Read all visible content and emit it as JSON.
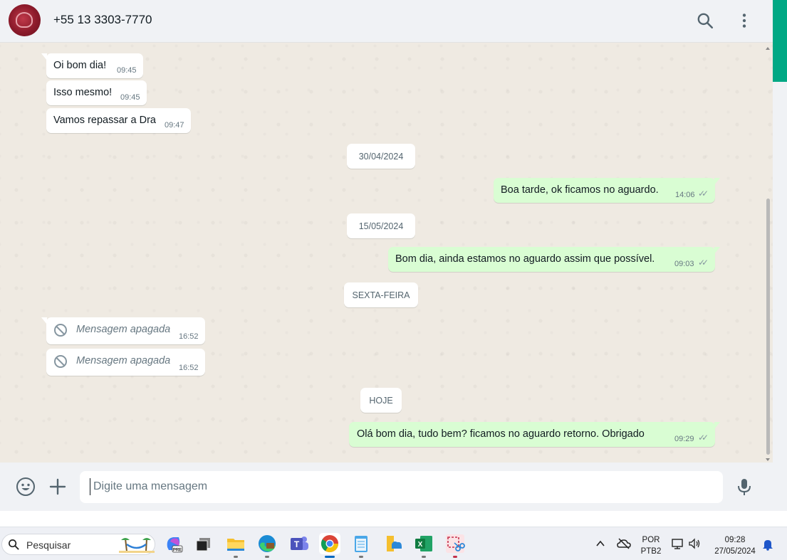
{
  "header": {
    "contact_name": "+55 13 3303-7770",
    "icons": [
      "search-icon",
      "menu-dots-icon"
    ]
  },
  "messages": [
    {
      "direction": "in",
      "text": "Oi bom dia!",
      "time": "09:45"
    },
    {
      "direction": "in",
      "text": "Isso mesmo!",
      "time": "09:45"
    },
    {
      "direction": "in",
      "text": "Vamos repassar a Dra",
      "time": "09:47"
    },
    {
      "divider": "30/04/2024"
    },
    {
      "direction": "out",
      "text": "Boa tarde, ok ficamos no aguardo.",
      "time": "14:06",
      "status": "read-ticks"
    },
    {
      "divider": "15/05/2024"
    },
    {
      "direction": "out",
      "text": "Bom dia, ainda estamos no aguardo assim que possível.",
      "time": "09:03",
      "status": "read-ticks"
    },
    {
      "divider": "SEXTA-FEIRA"
    },
    {
      "direction": "in",
      "deleted": true,
      "text": "Mensagem apagada",
      "time": "16:52"
    },
    {
      "direction": "in",
      "deleted": true,
      "text": "Mensagem apagada",
      "time": "16:52"
    },
    {
      "divider": "HOJE"
    },
    {
      "direction": "out",
      "text": "Olá bom dia, tudo bem? ficamos no aguardo retorno. Obrigado",
      "time": "09:29",
      "status": "read-ticks"
    }
  ],
  "composer": {
    "placeholder": "Digite uma mensagem",
    "icons": [
      "emoji-icon",
      "plus-icon",
      "microphone-icon"
    ]
  },
  "taskbar": {
    "search_label": "Pesquisar",
    "apps": [
      "copilot-icon",
      "task-view-icon",
      "file-explorer-icon",
      "edge-icon",
      "teams-icon",
      "chrome-icon",
      "notepad-icon",
      "files-icon",
      "excel-icon",
      "snipping-tool-icon"
    ],
    "language_top": "POR",
    "language_bottom": "PTB2",
    "clock_time": "09:28",
    "clock_date": "27/05/2024"
  },
  "colors": {
    "accent": "#00a884",
    "outgoing_bubble": "#d9fdd3",
    "incoming_bubble": "#ffffff",
    "chat_background": "#efeae2"
  }
}
